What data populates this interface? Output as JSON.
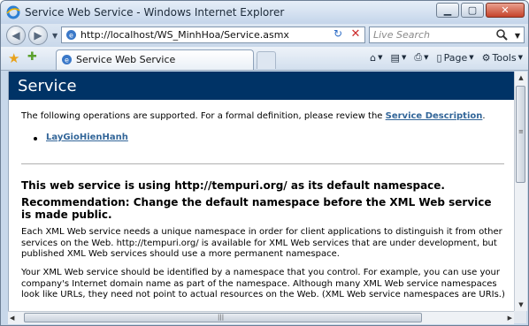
{
  "window": {
    "title": "Service Web Service - Windows Internet Explorer"
  },
  "address_bar": {
    "url": "http://localhost/WS_MinhHoa/Service.asmx",
    "search_placeholder": "Live Search"
  },
  "command_bar": {
    "tab_title": "Service Web Service",
    "page_label": "Page",
    "tools_label": "Tools"
  },
  "page": {
    "title": "Service",
    "intro_text": "The following operations are supported. For a formal definition, please review the ",
    "intro_link": "Service Description",
    "intro_end": ".",
    "operations": [
      "LayGioHienHanh"
    ],
    "namespace_heading": "This web service is using http://tempuri.org/ as its default namespace.",
    "recommendation_heading": "Recommendation: Change the default namespace before the XML Web service is made public.",
    "paragraph1": "Each XML Web service needs a unique namespace in order for client applications to distinguish it from other services on the Web. http://tempuri.org/ is available for XML Web services that are under development, but published XML Web services should use a more permanent namespace.",
    "paragraph2": "Your XML Web service should be identified by a namespace that you control. For example, you can use your company's Internet domain name as part of the namespace. Although many XML Web service namespaces look like URLs, they need not point to actual resources on the Web. (XML Web service namespaces are URIs.)"
  },
  "colors": {
    "banner": "#003366",
    "link": "#336699"
  },
  "icons": {
    "title": "ie-icon",
    "back": "back-arrow-icon",
    "forward": "forward-arrow-icon",
    "refresh": "refresh-icon",
    "stop": "stop-icon",
    "search": "search-icon",
    "favorites": "favorites-star-icon",
    "add_favorites": "add-favorites-icon",
    "home": "home-icon",
    "feeds": "feeds-icon",
    "print": "print-icon",
    "page": "page-icon",
    "tools": "tools-gear-icon"
  }
}
